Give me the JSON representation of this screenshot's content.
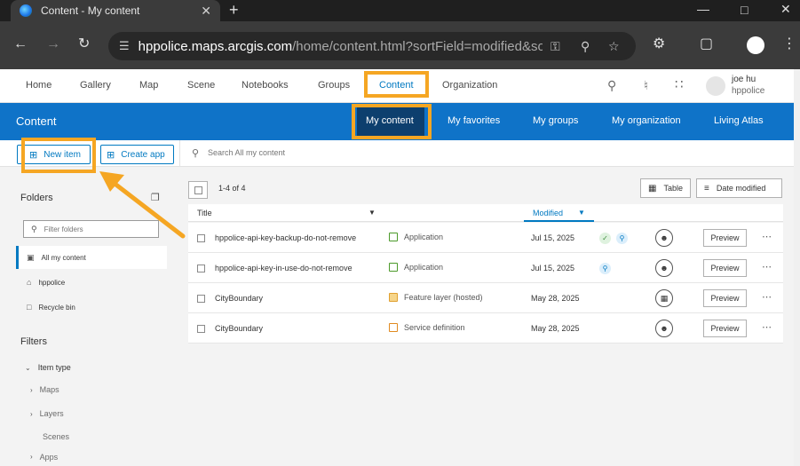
{
  "browser": {
    "tab_title": "Content - My content",
    "tab_close": "✕",
    "new_tab": "+",
    "url_host": "hppolice.maps.arcgis.com",
    "url_rest": "/home/content.html?sortField=modified&sor..."
  },
  "arcgis_nav": {
    "items": [
      "Home",
      "Gallery",
      "Map",
      "Scene",
      "Notebooks",
      "Groups",
      "Content",
      "Organization"
    ],
    "active": "Content",
    "user_name": "joe hu",
    "user_org": "hppolice"
  },
  "content_bar": {
    "heading": "Content",
    "tabs": [
      "My content",
      "My favorites",
      "My groups",
      "My organization",
      "Living Atlas"
    ],
    "active": "My content"
  },
  "toolbar": {
    "new_item_label": "New item",
    "create_app_label": "Create app",
    "search_placeholder": "Search All my content"
  },
  "folders": {
    "title": "Folders",
    "filter_placeholder": "Filter folders",
    "items": [
      "All my content",
      "hppolice",
      "Recycle bin"
    ]
  },
  "filters": {
    "title": "Filters",
    "item_type_label": "Item type",
    "children": [
      "Maps",
      "Layers",
      "Scenes",
      "Apps"
    ]
  },
  "table": {
    "count_label": "1-4 of 4",
    "view_label": "Table",
    "sort_label": "Date modified",
    "col_title": "Title",
    "col_modified": "Modified",
    "preview_label": "Preview",
    "rows": [
      {
        "title": "hppolice-api-key-backup-do-not-remove",
        "type": "Application",
        "modified": "Jul 15, 2025",
        "type_color": "#4c9a2a"
      },
      {
        "title": "hppolice-api-key-in-use-do-not-remove",
        "type": "Application",
        "modified": "Jul 15, 2025",
        "type_color": "#4c9a2a"
      },
      {
        "title": "CityBoundary",
        "type": "Feature layer (hosted)",
        "modified": "May 28, 2025",
        "type_color": "#e0a030"
      },
      {
        "title": "CityBoundary",
        "type": "Service definition",
        "modified": "May 28, 2025",
        "type_color": "#e08a20"
      }
    ]
  },
  "colors": {
    "accent": "#0079c1",
    "content_bar": "#0f73c8",
    "highlight": "#f5a623"
  }
}
